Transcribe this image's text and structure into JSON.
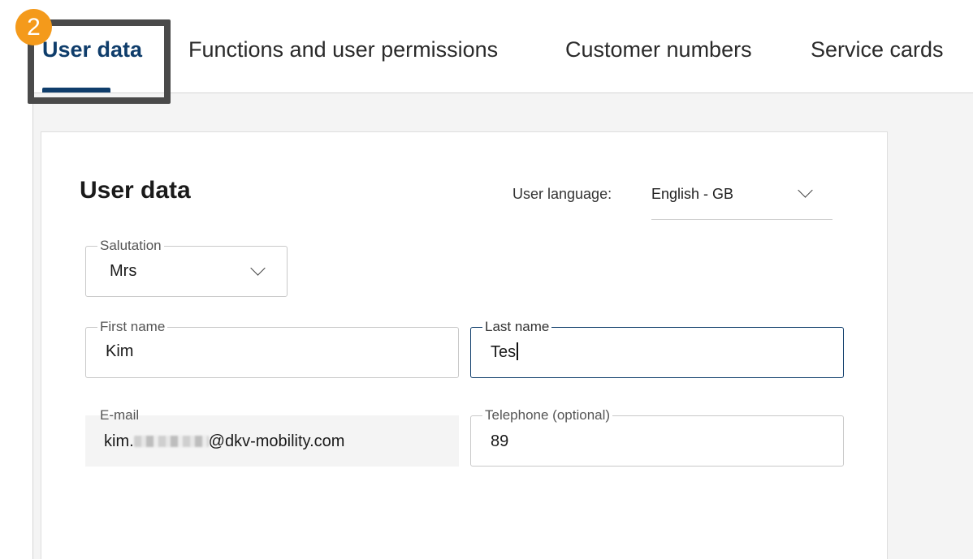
{
  "tabs": [
    {
      "label": "User data",
      "active": true
    },
    {
      "label": "Functions and user permissions",
      "active": false
    },
    {
      "label": "Customer numbers",
      "active": false
    },
    {
      "label": "Service cards",
      "active": false
    }
  ],
  "annotation": {
    "step": "2",
    "badge_color": "#f49a1b",
    "frame_color": "#4a4a4a"
  },
  "colors": {
    "accent": "#0f3d6b"
  },
  "form": {
    "title": "User data",
    "language": {
      "label": "User language:",
      "value": "English - GB",
      "icon": "chevron-down-icon"
    },
    "salutation": {
      "label": "Salutation",
      "value": "Mrs",
      "icon": "chevron-down-icon"
    },
    "first_name": {
      "label": "First name",
      "value": "Kim"
    },
    "last_name": {
      "label": "Last name",
      "value": "Tes",
      "focused": true
    },
    "email": {
      "label": "E-mail",
      "prefix": "kim.",
      "suffix": "@dkv-mobility.com",
      "redacted": true
    },
    "telephone": {
      "label": "Telephone (optional)",
      "value": "89"
    }
  }
}
